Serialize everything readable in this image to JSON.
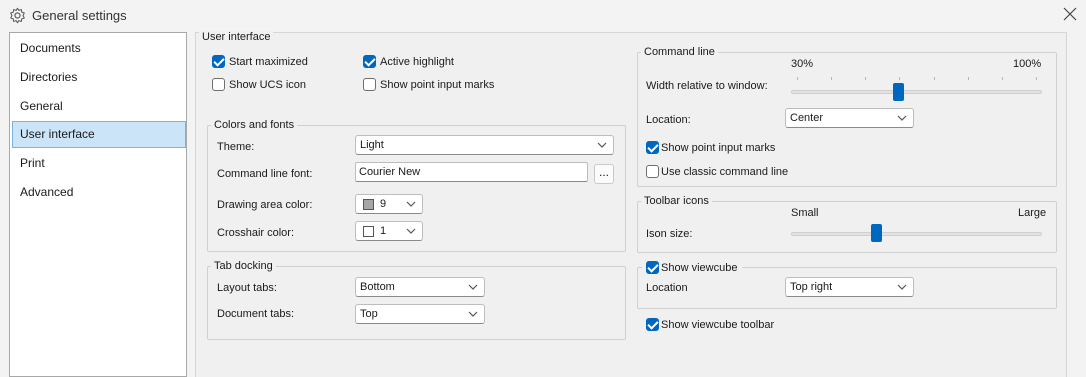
{
  "window": {
    "title": "General settings",
    "icon": "gear-icon"
  },
  "sidebar": {
    "items": [
      {
        "label": "Documents"
      },
      {
        "label": "Directories"
      },
      {
        "label": "General"
      },
      {
        "label": "User interface",
        "selected": true
      },
      {
        "label": "Print"
      },
      {
        "label": "Advanced"
      }
    ]
  },
  "ui_group": {
    "label": "User interface",
    "start_maximized": {
      "label": "Start maximized",
      "checked": true
    },
    "active_highlight": {
      "label": "Active highlight",
      "checked": true
    },
    "show_ucs_icon": {
      "label": "Show UCS icon",
      "checked": false
    },
    "show_point_input_marks": {
      "label": "Show point input marks",
      "checked": false
    }
  },
  "colors_fonts": {
    "label": "Colors and fonts",
    "theme_label": "Theme:",
    "theme_value": "Light",
    "cmd_font_label": "Command line font:",
    "cmd_font_value": "Courier New",
    "browse_label": "...",
    "drawing_color_label": "Drawing area color:",
    "drawing_color_value": "9",
    "drawing_color_swatch": "#a6a6a6",
    "crosshair_label": "Crosshair color:",
    "crosshair_value": "1",
    "crosshair_swatch": "#ffffff"
  },
  "tab_docking": {
    "label": "Tab docking",
    "layout_label": "Layout tabs:",
    "layout_value": "Bottom",
    "document_label": "Document tabs:",
    "document_value": "Top"
  },
  "command_line": {
    "label": "Command line",
    "min_label": "30%",
    "max_label": "100%",
    "width_label": "Width relative to window:",
    "width_value_fraction": 0.43,
    "location_label": "Location:",
    "location_value": "Center",
    "show_point_input_marks": {
      "label": "Show point input marks",
      "checked": true
    },
    "use_classic": {
      "label": "Use classic command line",
      "checked": false
    }
  },
  "toolbar_icons": {
    "label": "Toolbar icons",
    "small_label": "Small",
    "large_label": "Large",
    "size_label": "Ison size:",
    "size_value_fraction": 0.34
  },
  "viewcube": {
    "show": {
      "label": "Show viewcube",
      "checked": true
    },
    "location_label": "Location",
    "location_value": "Top right",
    "toolbar": {
      "label": "Show viewcube toolbar",
      "checked": true
    }
  },
  "colors": {
    "accent": "#0067c0",
    "selection_bg": "#cce4f7"
  }
}
